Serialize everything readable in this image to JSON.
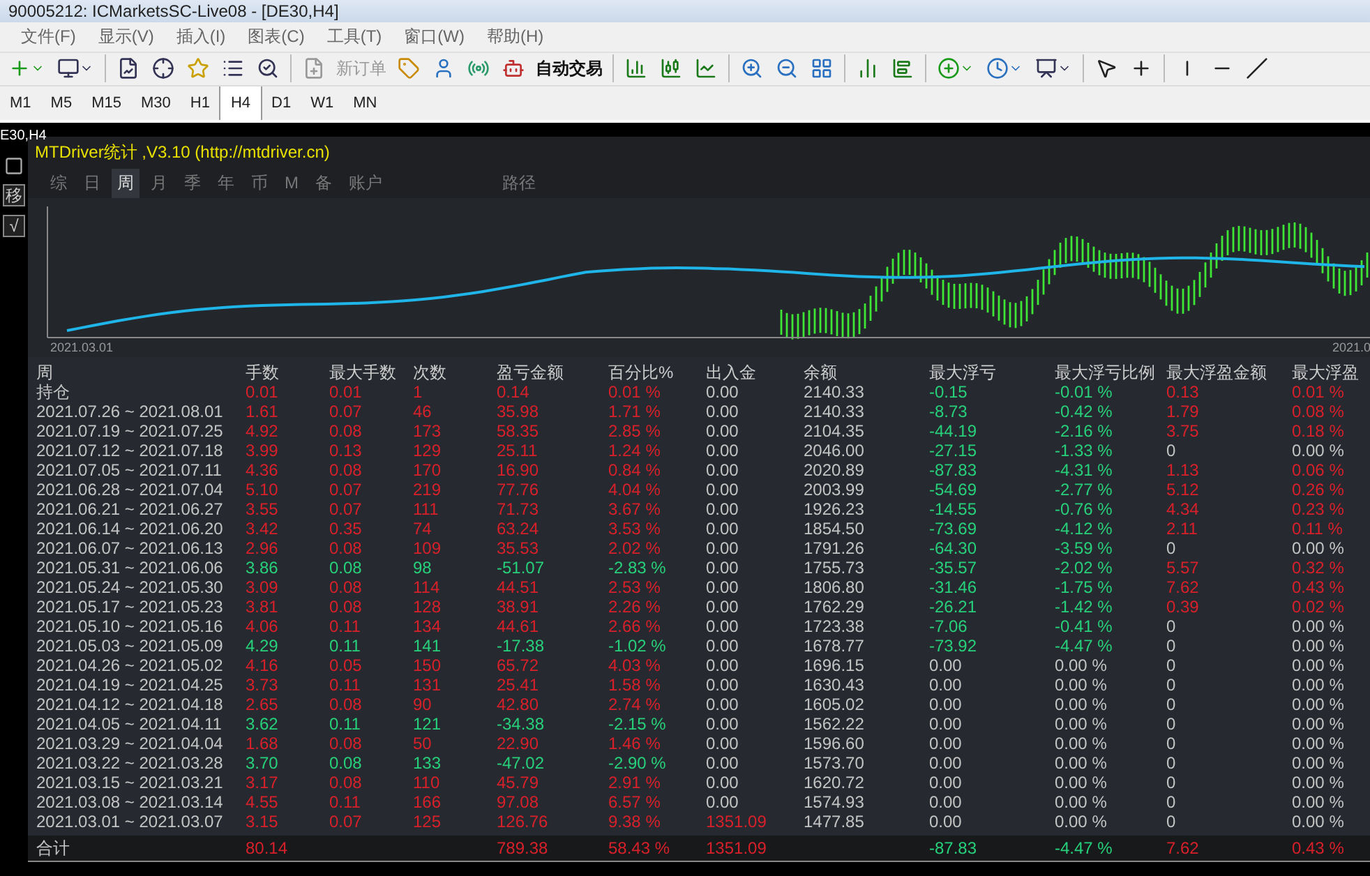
{
  "window": {
    "title": "90005212: ICMarketsSC-Live08 - [DE30,H4]"
  },
  "menu": [
    "文件(F)",
    "显示(V)",
    "插入(I)",
    "图表(C)",
    "工具(T)",
    "窗口(W)",
    "帮助(H)"
  ],
  "toolbar": {
    "buttons": [
      {
        "label": "新订单",
        "disabled": true
      },
      {
        "label": "自动交易",
        "disabled": false
      }
    ]
  },
  "timeframes": [
    {
      "label": "M1",
      "selected": false
    },
    {
      "label": "M5",
      "selected": false
    },
    {
      "label": "M15",
      "selected": false
    },
    {
      "label": "M30",
      "selected": false
    },
    {
      "label": "H1",
      "selected": false
    },
    {
      "label": "H4",
      "selected": true
    },
    {
      "label": "D1",
      "selected": false
    },
    {
      "label": "W1",
      "selected": false
    },
    {
      "label": "MN",
      "selected": false
    }
  ],
  "chart": {
    "label": "E30,H4",
    "left_tools": [
      "移",
      "√"
    ]
  },
  "panel": {
    "title": "MTDriver统计 ,V3.10 (http://mtdriver.cn)",
    "tabs": [
      {
        "label": "综",
        "selected": false
      },
      {
        "label": "日",
        "selected": false
      },
      {
        "label": "周",
        "selected": true
      },
      {
        "label": "月",
        "selected": false
      },
      {
        "label": "季",
        "selected": false
      },
      {
        "label": "年",
        "selected": false
      },
      {
        "label": "币",
        "selected": false
      },
      {
        "label": "M",
        "selected": false
      },
      {
        "label": "备",
        "selected": false
      },
      {
        "label": "账户",
        "selected": false
      }
    ],
    "path_tab": "路径",
    "equity_chart": {
      "start_label": "2021.03.01",
      "end_label": "2021.0"
    },
    "table": {
      "columns": [
        "周",
        "手数",
        "最大手数",
        "次数",
        "盈亏金额",
        "百分比%",
        "出入金",
        "余额",
        "最大浮亏",
        "最大浮亏比例",
        "最大浮盈金额",
        "最大浮盈"
      ],
      "rows": [
        [
          {
            "text": "持仓",
            "color": "#c4c4c4"
          },
          {
            "text": "0.01",
            "color": "#d8202a"
          },
          {
            "text": "0.01",
            "color": "#d8202a"
          },
          {
            "text": "1",
            "color": "#d8202a"
          },
          {
            "text": "0.14",
            "color": "#d8202a"
          },
          {
            "text": "0.01 %",
            "color": "#d8202a"
          },
          {
            "text": "0.00",
            "color": "#c4c4c4"
          },
          {
            "text": "2140.33",
            "color": "#c4c4c4"
          },
          {
            "text": "-0.15",
            "color": "#27d07a"
          },
          {
            "text": "-0.01 %",
            "color": "#27d07a"
          },
          {
            "text": "0.13",
            "color": "#d8202a"
          },
          {
            "text": "0.01 %",
            "color": "#d8202a"
          }
        ],
        [
          {
            "text": "2021.07.26 ~ 2021.08.01",
            "color": "#c4c4c4"
          },
          {
            "text": "1.61",
            "color": "#d8202a"
          },
          {
            "text": "0.07",
            "color": "#d8202a"
          },
          {
            "text": "46",
            "color": "#d8202a"
          },
          {
            "text": "35.98",
            "color": "#d8202a"
          },
          {
            "text": "1.71 %",
            "color": "#d8202a"
          },
          {
            "text": "0.00",
            "color": "#c4c4c4"
          },
          {
            "text": "2140.33",
            "color": "#c4c4c4"
          },
          {
            "text": "-8.73",
            "color": "#27d07a"
          },
          {
            "text": "-0.42 %",
            "color": "#27d07a"
          },
          {
            "text": "1.79",
            "color": "#d8202a"
          },
          {
            "text": "0.08 %",
            "color": "#d8202a"
          }
        ],
        [
          {
            "text": "2021.07.19 ~ 2021.07.25",
            "color": "#c4c4c4"
          },
          {
            "text": "4.92",
            "color": "#d8202a"
          },
          {
            "text": "0.08",
            "color": "#d8202a"
          },
          {
            "text": "173",
            "color": "#d8202a"
          },
          {
            "text": "58.35",
            "color": "#d8202a"
          },
          {
            "text": "2.85 %",
            "color": "#d8202a"
          },
          {
            "text": "0.00",
            "color": "#c4c4c4"
          },
          {
            "text": "2104.35",
            "color": "#c4c4c4"
          },
          {
            "text": "-44.19",
            "color": "#27d07a"
          },
          {
            "text": "-2.16 %",
            "color": "#27d07a"
          },
          {
            "text": "3.75",
            "color": "#d8202a"
          },
          {
            "text": "0.18 %",
            "color": "#d8202a"
          }
        ],
        [
          {
            "text": "2021.07.12 ~ 2021.07.18",
            "color": "#c4c4c4"
          },
          {
            "text": "3.99",
            "color": "#d8202a"
          },
          {
            "text": "0.13",
            "color": "#d8202a"
          },
          {
            "text": "129",
            "color": "#d8202a"
          },
          {
            "text": "25.11",
            "color": "#d8202a"
          },
          {
            "text": "1.24 %",
            "color": "#d8202a"
          },
          {
            "text": "0.00",
            "color": "#c4c4c4"
          },
          {
            "text": "2046.00",
            "color": "#c4c4c4"
          },
          {
            "text": "-27.15",
            "color": "#27d07a"
          },
          {
            "text": "-1.33 %",
            "color": "#27d07a"
          },
          {
            "text": "0",
            "color": "#c4c4c4"
          },
          {
            "text": "0.00 %",
            "color": "#c4c4c4"
          }
        ],
        [
          {
            "text": "2021.07.05 ~ 2021.07.11",
            "color": "#c4c4c4"
          },
          {
            "text": "4.36",
            "color": "#d8202a"
          },
          {
            "text": "0.08",
            "color": "#d8202a"
          },
          {
            "text": "170",
            "color": "#d8202a"
          },
          {
            "text": "16.90",
            "color": "#d8202a"
          },
          {
            "text": "0.84 %",
            "color": "#d8202a"
          },
          {
            "text": "0.00",
            "color": "#c4c4c4"
          },
          {
            "text": "2020.89",
            "color": "#c4c4c4"
          },
          {
            "text": "-87.83",
            "color": "#27d07a"
          },
          {
            "text": "-4.31 %",
            "color": "#27d07a"
          },
          {
            "text": "1.13",
            "color": "#d8202a"
          },
          {
            "text": "0.06 %",
            "color": "#d8202a"
          }
        ],
        [
          {
            "text": "2021.06.28 ~ 2021.07.04",
            "color": "#c4c4c4"
          },
          {
            "text": "5.10",
            "color": "#d8202a"
          },
          {
            "text": "0.07",
            "color": "#d8202a"
          },
          {
            "text": "219",
            "color": "#d8202a"
          },
          {
            "text": "77.76",
            "color": "#d8202a"
          },
          {
            "text": "4.04 %",
            "color": "#d8202a"
          },
          {
            "text": "0.00",
            "color": "#c4c4c4"
          },
          {
            "text": "2003.99",
            "color": "#c4c4c4"
          },
          {
            "text": "-54.69",
            "color": "#27d07a"
          },
          {
            "text": "-2.77 %",
            "color": "#27d07a"
          },
          {
            "text": "5.12",
            "color": "#d8202a"
          },
          {
            "text": "0.26 %",
            "color": "#d8202a"
          }
        ],
        [
          {
            "text": "2021.06.21 ~ 2021.06.27",
            "color": "#c4c4c4"
          },
          {
            "text": "3.55",
            "color": "#d8202a"
          },
          {
            "text": "0.07",
            "color": "#d8202a"
          },
          {
            "text": "111",
            "color": "#d8202a"
          },
          {
            "text": "71.73",
            "color": "#d8202a"
          },
          {
            "text": "3.67 %",
            "color": "#d8202a"
          },
          {
            "text": "0.00",
            "color": "#c4c4c4"
          },
          {
            "text": "1926.23",
            "color": "#c4c4c4"
          },
          {
            "text": "-14.55",
            "color": "#27d07a"
          },
          {
            "text": "-0.76 %",
            "color": "#27d07a"
          },
          {
            "text": "4.34",
            "color": "#d8202a"
          },
          {
            "text": "0.23 %",
            "color": "#d8202a"
          }
        ],
        [
          {
            "text": "2021.06.14 ~ 2021.06.20",
            "color": "#c4c4c4"
          },
          {
            "text": "3.42",
            "color": "#d8202a"
          },
          {
            "text": "0.35",
            "color": "#d8202a"
          },
          {
            "text": "74",
            "color": "#d8202a"
          },
          {
            "text": "63.24",
            "color": "#d8202a"
          },
          {
            "text": "3.53 %",
            "color": "#d8202a"
          },
          {
            "text": "0.00",
            "color": "#c4c4c4"
          },
          {
            "text": "1854.50",
            "color": "#c4c4c4"
          },
          {
            "text": "-73.69",
            "color": "#27d07a"
          },
          {
            "text": "-4.12 %",
            "color": "#27d07a"
          },
          {
            "text": "2.11",
            "color": "#d8202a"
          },
          {
            "text": "0.11 %",
            "color": "#d8202a"
          }
        ],
        [
          {
            "text": "2021.06.07 ~ 2021.06.13",
            "color": "#c4c4c4"
          },
          {
            "text": "2.96",
            "color": "#d8202a"
          },
          {
            "text": "0.08",
            "color": "#d8202a"
          },
          {
            "text": "109",
            "color": "#d8202a"
          },
          {
            "text": "35.53",
            "color": "#d8202a"
          },
          {
            "text": "2.02 %",
            "color": "#d8202a"
          },
          {
            "text": "0.00",
            "color": "#c4c4c4"
          },
          {
            "text": "1791.26",
            "color": "#c4c4c4"
          },
          {
            "text": "-64.30",
            "color": "#27d07a"
          },
          {
            "text": "-3.59 %",
            "color": "#27d07a"
          },
          {
            "text": "0",
            "color": "#c4c4c4"
          },
          {
            "text": "0.00 %",
            "color": "#c4c4c4"
          }
        ],
        [
          {
            "text": "2021.05.31 ~ 2021.06.06",
            "color": "#c4c4c4"
          },
          {
            "text": "3.86",
            "color": "#27d07a"
          },
          {
            "text": "0.08",
            "color": "#27d07a"
          },
          {
            "text": "98",
            "color": "#27d07a"
          },
          {
            "text": "-51.07",
            "color": "#27d07a"
          },
          {
            "text": "-2.83 %",
            "color": "#27d07a"
          },
          {
            "text": "0.00",
            "color": "#c4c4c4"
          },
          {
            "text": "1755.73",
            "color": "#c4c4c4"
          },
          {
            "text": "-35.57",
            "color": "#27d07a"
          },
          {
            "text": "-2.02 %",
            "color": "#27d07a"
          },
          {
            "text": "5.57",
            "color": "#d8202a"
          },
          {
            "text": "0.32 %",
            "color": "#d8202a"
          }
        ],
        [
          {
            "text": "2021.05.24 ~ 2021.05.30",
            "color": "#c4c4c4"
          },
          {
            "text": "3.09",
            "color": "#d8202a"
          },
          {
            "text": "0.08",
            "color": "#d8202a"
          },
          {
            "text": "114",
            "color": "#d8202a"
          },
          {
            "text": "44.51",
            "color": "#d8202a"
          },
          {
            "text": "2.53 %",
            "color": "#d8202a"
          },
          {
            "text": "0.00",
            "color": "#c4c4c4"
          },
          {
            "text": "1806.80",
            "color": "#c4c4c4"
          },
          {
            "text": "-31.46",
            "color": "#27d07a"
          },
          {
            "text": "-1.75 %",
            "color": "#27d07a"
          },
          {
            "text": "7.62",
            "color": "#d8202a"
          },
          {
            "text": "0.43 %",
            "color": "#d8202a"
          }
        ],
        [
          {
            "text": "2021.05.17 ~ 2021.05.23",
            "color": "#c4c4c4"
          },
          {
            "text": "3.81",
            "color": "#d8202a"
          },
          {
            "text": "0.08",
            "color": "#d8202a"
          },
          {
            "text": "128",
            "color": "#d8202a"
          },
          {
            "text": "38.91",
            "color": "#d8202a"
          },
          {
            "text": "2.26 %",
            "color": "#d8202a"
          },
          {
            "text": "0.00",
            "color": "#c4c4c4"
          },
          {
            "text": "1762.29",
            "color": "#c4c4c4"
          },
          {
            "text": "-26.21",
            "color": "#27d07a"
          },
          {
            "text": "-1.42 %",
            "color": "#27d07a"
          },
          {
            "text": "0.39",
            "color": "#d8202a"
          },
          {
            "text": "0.02 %",
            "color": "#d8202a"
          }
        ],
        [
          {
            "text": "2021.05.10 ~ 2021.05.16",
            "color": "#c4c4c4"
          },
          {
            "text": "4.06",
            "color": "#d8202a"
          },
          {
            "text": "0.11",
            "color": "#d8202a"
          },
          {
            "text": "134",
            "color": "#d8202a"
          },
          {
            "text": "44.61",
            "color": "#d8202a"
          },
          {
            "text": "2.66 %",
            "color": "#d8202a"
          },
          {
            "text": "0.00",
            "color": "#c4c4c4"
          },
          {
            "text": "1723.38",
            "color": "#c4c4c4"
          },
          {
            "text": "-7.06",
            "color": "#27d07a"
          },
          {
            "text": "-0.41 %",
            "color": "#27d07a"
          },
          {
            "text": "0",
            "color": "#c4c4c4"
          },
          {
            "text": "0.00 %",
            "color": "#c4c4c4"
          }
        ],
        [
          {
            "text": "2021.05.03 ~ 2021.05.09",
            "color": "#c4c4c4"
          },
          {
            "text": "4.29",
            "color": "#27d07a"
          },
          {
            "text": "0.11",
            "color": "#27d07a"
          },
          {
            "text": "141",
            "color": "#27d07a"
          },
          {
            "text": "-17.38",
            "color": "#27d07a"
          },
          {
            "text": "-1.02 %",
            "color": "#27d07a"
          },
          {
            "text": "0.00",
            "color": "#c4c4c4"
          },
          {
            "text": "1678.77",
            "color": "#c4c4c4"
          },
          {
            "text": "-73.92",
            "color": "#27d07a"
          },
          {
            "text": "-4.47 %",
            "color": "#27d07a"
          },
          {
            "text": "0",
            "color": "#c4c4c4"
          },
          {
            "text": "0.00 %",
            "color": "#c4c4c4"
          }
        ],
        [
          {
            "text": "2021.04.26 ~ 2021.05.02",
            "color": "#c4c4c4"
          },
          {
            "text": "4.16",
            "color": "#d8202a"
          },
          {
            "text": "0.05",
            "color": "#d8202a"
          },
          {
            "text": "150",
            "color": "#d8202a"
          },
          {
            "text": "65.72",
            "color": "#d8202a"
          },
          {
            "text": "4.03 %",
            "color": "#d8202a"
          },
          {
            "text": "0.00",
            "color": "#c4c4c4"
          },
          {
            "text": "1696.15",
            "color": "#c4c4c4"
          },
          {
            "text": "0.00",
            "color": "#c4c4c4"
          },
          {
            "text": "0.00 %",
            "color": "#c4c4c4"
          },
          {
            "text": "0",
            "color": "#c4c4c4"
          },
          {
            "text": "0.00 %",
            "color": "#c4c4c4"
          }
        ],
        [
          {
            "text": "2021.04.19 ~ 2021.04.25",
            "color": "#c4c4c4"
          },
          {
            "text": "3.73",
            "color": "#d8202a"
          },
          {
            "text": "0.11",
            "color": "#d8202a"
          },
          {
            "text": "131",
            "color": "#d8202a"
          },
          {
            "text": "25.41",
            "color": "#d8202a"
          },
          {
            "text": "1.58 %",
            "color": "#d8202a"
          },
          {
            "text": "0.00",
            "color": "#c4c4c4"
          },
          {
            "text": "1630.43",
            "color": "#c4c4c4"
          },
          {
            "text": "0.00",
            "color": "#c4c4c4"
          },
          {
            "text": "0.00 %",
            "color": "#c4c4c4"
          },
          {
            "text": "0",
            "color": "#c4c4c4"
          },
          {
            "text": "0.00 %",
            "color": "#c4c4c4"
          }
        ],
        [
          {
            "text": "2021.04.12 ~ 2021.04.18",
            "color": "#c4c4c4"
          },
          {
            "text": "2.65",
            "color": "#d8202a"
          },
          {
            "text": "0.08",
            "color": "#d8202a"
          },
          {
            "text": "90",
            "color": "#d8202a"
          },
          {
            "text": "42.80",
            "color": "#d8202a"
          },
          {
            "text": "2.74 %",
            "color": "#d8202a"
          },
          {
            "text": "0.00",
            "color": "#c4c4c4"
          },
          {
            "text": "1605.02",
            "color": "#c4c4c4"
          },
          {
            "text": "0.00",
            "color": "#c4c4c4"
          },
          {
            "text": "0.00 %",
            "color": "#c4c4c4"
          },
          {
            "text": "0",
            "color": "#c4c4c4"
          },
          {
            "text": "0.00 %",
            "color": "#c4c4c4"
          }
        ],
        [
          {
            "text": "2021.04.05 ~ 2021.04.11",
            "color": "#c4c4c4"
          },
          {
            "text": "3.62",
            "color": "#27d07a"
          },
          {
            "text": "0.11",
            "color": "#27d07a"
          },
          {
            "text": "121",
            "color": "#27d07a"
          },
          {
            "text": "-34.38",
            "color": "#27d07a"
          },
          {
            "text": "-2.15 %",
            "color": "#27d07a"
          },
          {
            "text": "0.00",
            "color": "#c4c4c4"
          },
          {
            "text": "1562.22",
            "color": "#c4c4c4"
          },
          {
            "text": "0.00",
            "color": "#c4c4c4"
          },
          {
            "text": "0.00 %",
            "color": "#c4c4c4"
          },
          {
            "text": "0",
            "color": "#c4c4c4"
          },
          {
            "text": "0.00 %",
            "color": "#c4c4c4"
          }
        ],
        [
          {
            "text": "2021.03.29 ~ 2021.04.04",
            "color": "#c4c4c4"
          },
          {
            "text": "1.68",
            "color": "#d8202a"
          },
          {
            "text": "0.08",
            "color": "#d8202a"
          },
          {
            "text": "50",
            "color": "#d8202a"
          },
          {
            "text": "22.90",
            "color": "#d8202a"
          },
          {
            "text": "1.46 %",
            "color": "#d8202a"
          },
          {
            "text": "0.00",
            "color": "#c4c4c4"
          },
          {
            "text": "1596.60",
            "color": "#c4c4c4"
          },
          {
            "text": "0.00",
            "color": "#c4c4c4"
          },
          {
            "text": "0.00 %",
            "color": "#c4c4c4"
          },
          {
            "text": "0",
            "color": "#c4c4c4"
          },
          {
            "text": "0.00 %",
            "color": "#c4c4c4"
          }
        ],
        [
          {
            "text": "2021.03.22 ~ 2021.03.28",
            "color": "#c4c4c4"
          },
          {
            "text": "3.70",
            "color": "#27d07a"
          },
          {
            "text": "0.08",
            "color": "#27d07a"
          },
          {
            "text": "133",
            "color": "#27d07a"
          },
          {
            "text": "-47.02",
            "color": "#27d07a"
          },
          {
            "text": "-2.90 %",
            "color": "#27d07a"
          },
          {
            "text": "0.00",
            "color": "#c4c4c4"
          },
          {
            "text": "1573.70",
            "color": "#c4c4c4"
          },
          {
            "text": "0.00",
            "color": "#c4c4c4"
          },
          {
            "text": "0.00 %",
            "color": "#c4c4c4"
          },
          {
            "text": "0",
            "color": "#c4c4c4"
          },
          {
            "text": "0.00 %",
            "color": "#c4c4c4"
          }
        ],
        [
          {
            "text": "2021.03.15 ~ 2021.03.21",
            "color": "#c4c4c4"
          },
          {
            "text": "3.17",
            "color": "#d8202a"
          },
          {
            "text": "0.08",
            "color": "#d8202a"
          },
          {
            "text": "110",
            "color": "#d8202a"
          },
          {
            "text": "45.79",
            "color": "#d8202a"
          },
          {
            "text": "2.91 %",
            "color": "#d8202a"
          },
          {
            "text": "0.00",
            "color": "#c4c4c4"
          },
          {
            "text": "1620.72",
            "color": "#c4c4c4"
          },
          {
            "text": "0.00",
            "color": "#c4c4c4"
          },
          {
            "text": "0.00 %",
            "color": "#c4c4c4"
          },
          {
            "text": "0",
            "color": "#c4c4c4"
          },
          {
            "text": "0.00 %",
            "color": "#c4c4c4"
          }
        ],
        [
          {
            "text": "2021.03.08 ~ 2021.03.14",
            "color": "#c4c4c4"
          },
          {
            "text": "4.55",
            "color": "#d8202a"
          },
          {
            "text": "0.11",
            "color": "#d8202a"
          },
          {
            "text": "166",
            "color": "#d8202a"
          },
          {
            "text": "97.08",
            "color": "#d8202a"
          },
          {
            "text": "6.57 %",
            "color": "#d8202a"
          },
          {
            "text": "0.00",
            "color": "#c4c4c4"
          },
          {
            "text": "1574.93",
            "color": "#c4c4c4"
          },
          {
            "text": "0.00",
            "color": "#c4c4c4"
          },
          {
            "text": "0.00 %",
            "color": "#c4c4c4"
          },
          {
            "text": "0",
            "color": "#c4c4c4"
          },
          {
            "text": "0.00 %",
            "color": "#c4c4c4"
          }
        ],
        [
          {
            "text": "2021.03.01 ~ 2021.03.07",
            "color": "#c4c4c4"
          },
          {
            "text": "3.15",
            "color": "#d8202a"
          },
          {
            "text": "0.07",
            "color": "#d8202a"
          },
          {
            "text": "125",
            "color": "#d8202a"
          },
          {
            "text": "126.76",
            "color": "#d8202a"
          },
          {
            "text": "9.38 %",
            "color": "#d8202a"
          },
          {
            "text": "1351.09",
            "color": "#d8202a"
          },
          {
            "text": "1477.85",
            "color": "#c4c4c4"
          },
          {
            "text": "0.00",
            "color": "#c4c4c4"
          },
          {
            "text": "0.00 %",
            "color": "#c4c4c4"
          },
          {
            "text": "0",
            "color": "#c4c4c4"
          },
          {
            "text": "0.00 %",
            "color": "#c4c4c4"
          }
        ],
        [
          {
            "text": "合计",
            "color": "#c4c4c4"
          },
          {
            "text": "80.14",
            "color": "#d8202a"
          },
          null,
          null,
          {
            "text": "789.38",
            "color": "#d8202a"
          },
          {
            "text": "58.43 %",
            "color": "#d8202a"
          },
          {
            "text": "1351.09",
            "color": "#d8202a"
          },
          null,
          {
            "text": "-87.83",
            "color": "#27d07a"
          },
          {
            "text": "-4.47 %",
            "color": "#27d07a"
          },
          {
            "text": "7.62",
            "color": "#d8202a"
          },
          {
            "text": "0.43 %",
            "color": "#d8202a"
          }
        ]
      ]
    }
  }
}
